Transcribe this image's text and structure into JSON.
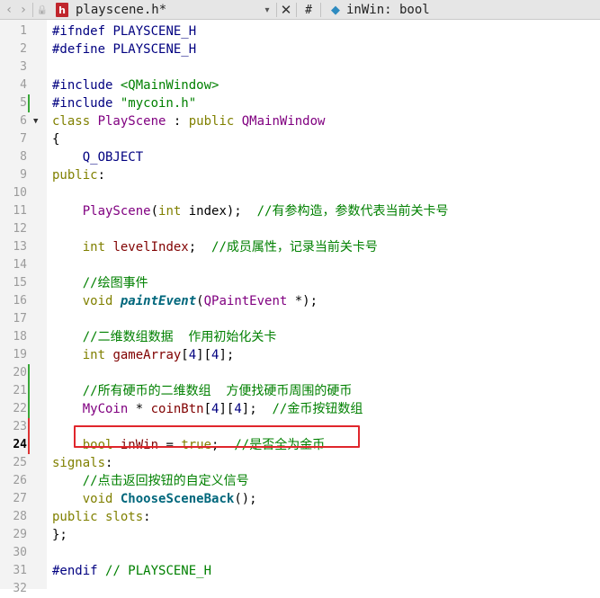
{
  "tabbar": {
    "back_icon": "‹",
    "forward_icon": "›",
    "lock_icon": "🔒",
    "file_icon_letter": "h",
    "file_name": "playscene.h*",
    "dropdown_icon": "▾",
    "close_icon": "✕",
    "hash_label": "#",
    "symbol_icon": "◆",
    "symbol_label": "inWin: bool"
  },
  "editor": {
    "current_line": 24,
    "lines": [
      {
        "n": "1",
        "tokens": [
          [
            "pre",
            "#ifndef "
          ],
          [
            "macro",
            "PLAYSCENE_H"
          ]
        ]
      },
      {
        "n": "2",
        "tokens": [
          [
            "pre",
            "#define "
          ],
          [
            "macro",
            "PLAYSCENE_H"
          ]
        ]
      },
      {
        "n": "3",
        "tokens": []
      },
      {
        "n": "4",
        "tokens": [
          [
            "pre",
            "#include "
          ],
          [
            "str",
            "<QMainWindow>"
          ]
        ]
      },
      {
        "n": "5",
        "tokens": [
          [
            "pre",
            "#include "
          ],
          [
            "str",
            "\"mycoin.h\""
          ]
        ]
      },
      {
        "n": "6",
        "fold": true,
        "tokens": [
          [
            "kw",
            "class "
          ],
          [
            "type",
            "PlayScene"
          ],
          [
            "txt",
            " : "
          ],
          [
            "kw",
            "public "
          ],
          [
            "type",
            "QMainWindow"
          ]
        ]
      },
      {
        "n": "7",
        "tokens": [
          [
            "txt",
            "{"
          ]
        ]
      },
      {
        "n": "8",
        "tokens": [
          [
            "txt",
            "    "
          ],
          [
            "macro",
            "Q_OBJECT"
          ]
        ]
      },
      {
        "n": "9",
        "tokens": [
          [
            "kw",
            "public"
          ],
          [
            "txt",
            ":"
          ]
        ]
      },
      {
        "n": "10",
        "tokens": []
      },
      {
        "n": "11",
        "tokens": [
          [
            "txt",
            "    "
          ],
          [
            "type",
            "PlayScene"
          ],
          [
            "txt",
            "("
          ],
          [
            "kw",
            "int "
          ],
          [
            "txt",
            "index);  "
          ],
          [
            "com",
            "//有参构造，参数代表当前关卡号"
          ]
        ]
      },
      {
        "n": "12",
        "tokens": []
      },
      {
        "n": "13",
        "tokens": [
          [
            "txt",
            "    "
          ],
          [
            "kw",
            "int "
          ],
          [
            "fld",
            "levelIndex"
          ],
          [
            "txt",
            ";  "
          ],
          [
            "com",
            "//成员属性，记录当前关卡号"
          ]
        ]
      },
      {
        "n": "14",
        "tokens": []
      },
      {
        "n": "15",
        "tokens": [
          [
            "txt",
            "    "
          ],
          [
            "com",
            "//绘图事件"
          ]
        ]
      },
      {
        "n": "16",
        "tokens": [
          [
            "txt",
            "    "
          ],
          [
            "kw",
            "void "
          ],
          [
            "fnit",
            "paintEvent"
          ],
          [
            "txt",
            "("
          ],
          [
            "type",
            "QPaintEvent"
          ],
          [
            "txt",
            " *);"
          ]
        ]
      },
      {
        "n": "17",
        "tokens": []
      },
      {
        "n": "18",
        "tokens": [
          [
            "txt",
            "    "
          ],
          [
            "com",
            "//二维数组数据  作用初始化关卡"
          ]
        ]
      },
      {
        "n": "19",
        "tokens": [
          [
            "txt",
            "    "
          ],
          [
            "kw",
            "int "
          ],
          [
            "fld",
            "gameArray"
          ],
          [
            "txt",
            "["
          ],
          [
            "num",
            "4"
          ],
          [
            "txt",
            "]["
          ],
          [
            "num",
            "4"
          ],
          [
            "txt",
            "];"
          ]
        ]
      },
      {
        "n": "20",
        "tokens": []
      },
      {
        "n": "21",
        "tokens": [
          [
            "txt",
            "    "
          ],
          [
            "com",
            "//所有硬币的二维数组  方便找硬币周围的硬币"
          ]
        ]
      },
      {
        "n": "22",
        "tokens": [
          [
            "txt",
            "    "
          ],
          [
            "type",
            "MyCoin"
          ],
          [
            "txt",
            " * "
          ],
          [
            "fld",
            "coinBtn"
          ],
          [
            "txt",
            "["
          ],
          [
            "num",
            "4"
          ],
          [
            "txt",
            "]["
          ],
          [
            "num",
            "4"
          ],
          [
            "txt",
            "];  "
          ],
          [
            "com",
            "//金币按钮数组"
          ]
        ]
      },
      {
        "n": "23",
        "tokens": []
      },
      {
        "n": "24",
        "tokens": [
          [
            "txt",
            "    "
          ],
          [
            "kw",
            "bool "
          ],
          [
            "fld",
            "inWin"
          ],
          [
            "txt",
            " = "
          ],
          [
            "kw",
            "true"
          ],
          [
            "txt",
            ";  "
          ],
          [
            "com",
            "//是否全为金币"
          ]
        ]
      },
      {
        "n": "25",
        "tokens": [
          [
            "kw",
            "signals"
          ],
          [
            "txt",
            ":"
          ]
        ]
      },
      {
        "n": "26",
        "tokens": [
          [
            "txt",
            "    "
          ],
          [
            "com",
            "//点击返回按钮的自定义信号"
          ]
        ]
      },
      {
        "n": "27",
        "tokens": [
          [
            "txt",
            "    "
          ],
          [
            "kw",
            "void "
          ],
          [
            "fn",
            "ChooseSceneBack"
          ],
          [
            "txt",
            "();"
          ]
        ]
      },
      {
        "n": "28",
        "tokens": [
          [
            "kw",
            "public slots"
          ],
          [
            "txt",
            ":"
          ]
        ]
      },
      {
        "n": "29",
        "tokens": [
          [
            "txt",
            "};"
          ]
        ]
      },
      {
        "n": "30",
        "tokens": []
      },
      {
        "n": "31",
        "tokens": [
          [
            "pre",
            "#endif "
          ],
          [
            "com",
            "// PLAYSCENE_H"
          ]
        ]
      },
      {
        "n": "32",
        "tokens": []
      }
    ],
    "green_marks": [
      5,
      20,
      21,
      22
    ],
    "red_marks": [
      23,
      24
    ],
    "highlighted_line": 24
  }
}
